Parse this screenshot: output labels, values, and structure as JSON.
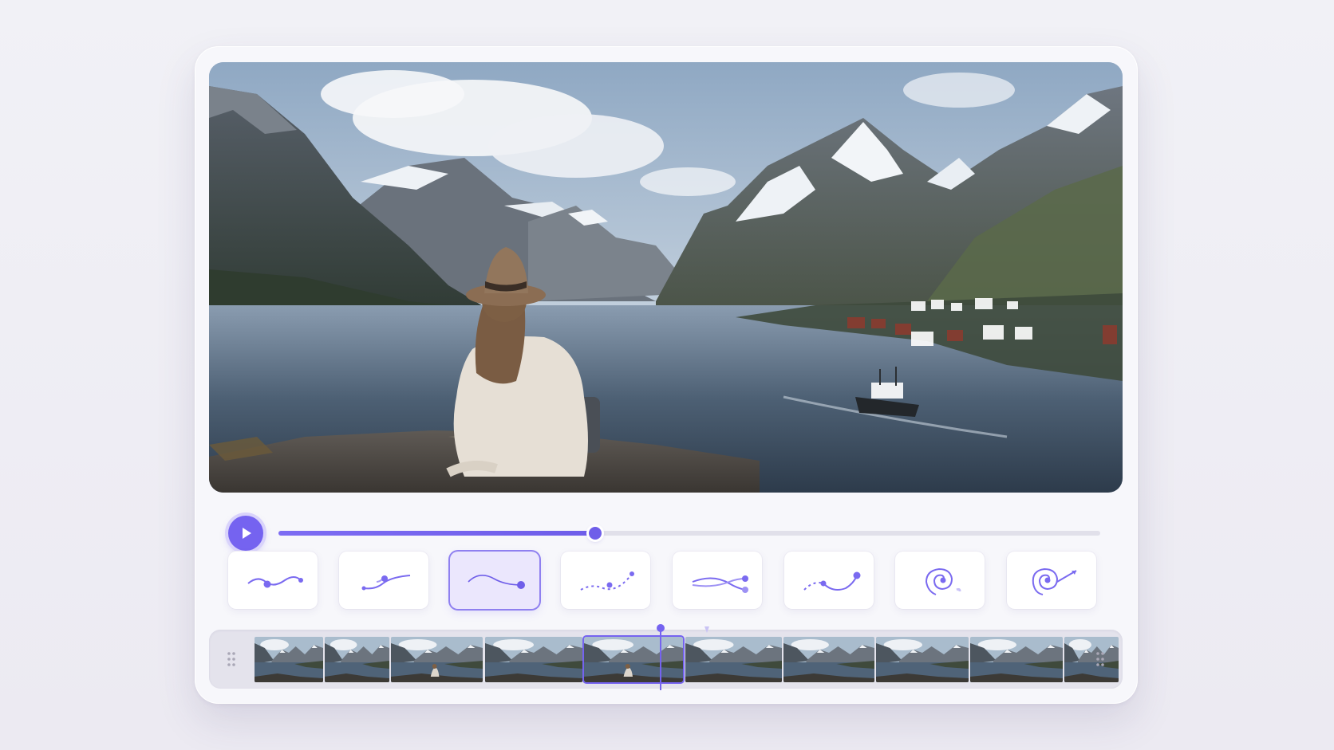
{
  "player": {
    "scene": "landscape-photo",
    "progress": 0.385,
    "is_playing": false,
    "accent_color": "#7563f0"
  },
  "icons": {
    "play": "play-icon",
    "grip": "drag-handle-icon"
  },
  "motion_presets": {
    "items": [
      {
        "id": "wave"
      },
      {
        "id": "s-curve"
      },
      {
        "id": "arc"
      },
      {
        "id": "dotted-rise"
      },
      {
        "id": "cross-curve"
      },
      {
        "id": "dotted-swoop"
      },
      {
        "id": "spiral"
      },
      {
        "id": "spiral-out"
      }
    ],
    "selected_index": 2
  },
  "timeline": {
    "frame_count": 11,
    "current_frame_index": 5
  }
}
